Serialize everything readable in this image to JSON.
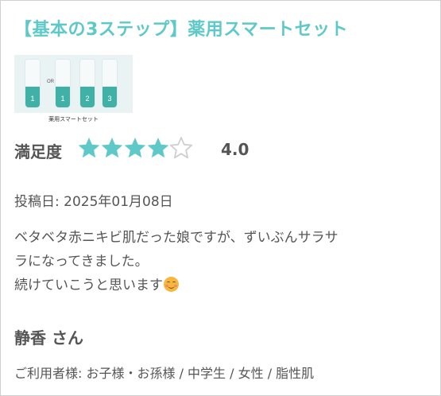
{
  "review": {
    "title": "【基本の3ステップ】薬用スマートセット",
    "product_image": {
      "caption": "薬用スマートセット",
      "or_label": "OR",
      "tube_numbers": [
        "1",
        "1",
        "2",
        "3"
      ]
    },
    "satisfaction_label": "満足度",
    "rating": {
      "value": 4,
      "max": 5,
      "display": "4.0"
    },
    "star_color": "#5fc9c9",
    "star_empty_color": "#cfcfcf",
    "posted_label": "投稿日: ",
    "posted_date": "2025年01月08日",
    "body_lines": [
      "ベタベタ赤ニキビ肌だった娘ですが、ずいぶんサラサ",
      "ラになってきました。",
      "続けていこうと思います"
    ],
    "body_emoji": "smiling-face-icon",
    "reviewer_name": "静香 さん",
    "users_label": "ご利用者様:",
    "users_value": " お子様・お孫様 / 中学生 / 女性 / 脂性肌"
  }
}
